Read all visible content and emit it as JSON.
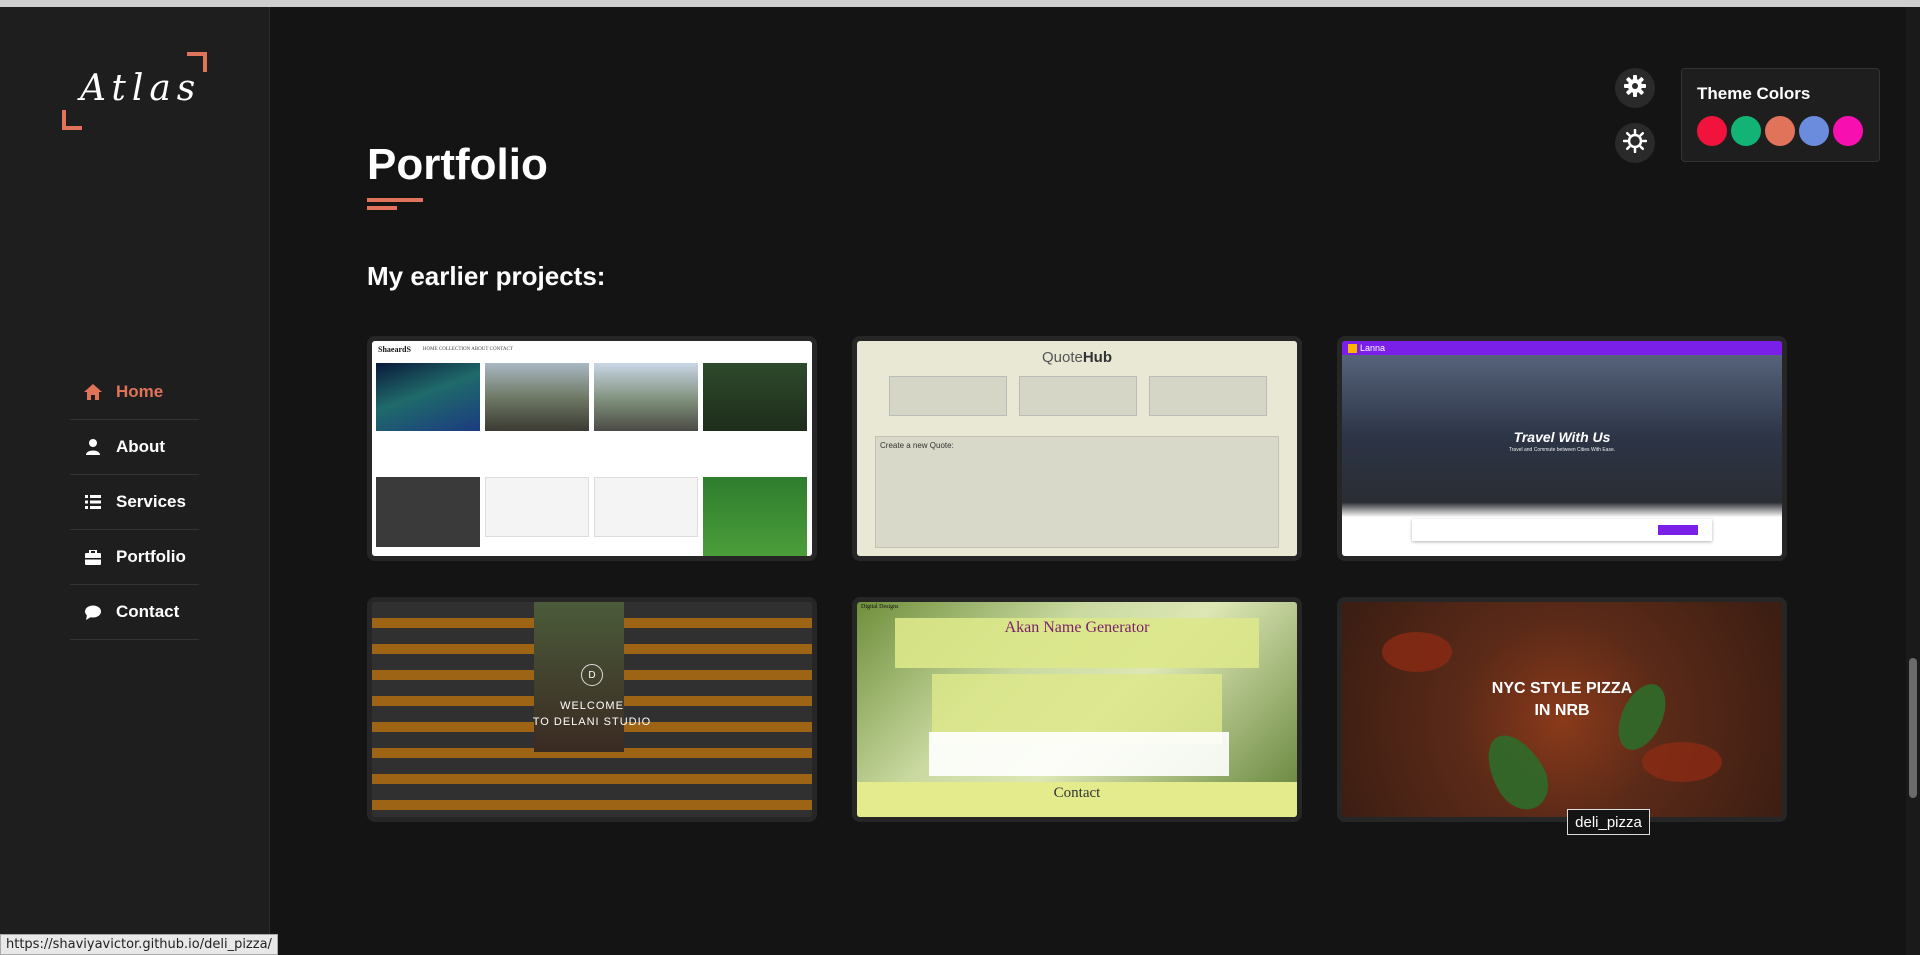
{
  "logo": {
    "text": "Atlas"
  },
  "nav": [
    {
      "label": "Home",
      "icon": "home-icon",
      "active": true
    },
    {
      "label": "About",
      "icon": "user-icon",
      "active": false
    },
    {
      "label": "Services",
      "icon": "list-icon",
      "active": false
    },
    {
      "label": "Portfolio",
      "icon": "briefcase-icon",
      "active": false
    },
    {
      "label": "Contact",
      "icon": "comment-icon",
      "active": false
    }
  ],
  "page": {
    "title": "Portfolio",
    "subtitle": "My earlier projects:"
  },
  "theme": {
    "title": "Theme Colors",
    "colors": [
      "#f2133c",
      "#12b374",
      "#e0735a",
      "#6b8cdc",
      "#f80fb0"
    ],
    "accent": "#e0735a"
  },
  "projects": [
    {
      "name": "shaeardi",
      "header": "ShaeardS",
      "links": "HOME  COLLECTION  ABOUT  CONTACT"
    },
    {
      "name": "quotehub",
      "title_a": "Quote",
      "title_b": "Hub",
      "form_title": "Create a new Quote:"
    },
    {
      "name": "lanna",
      "brand": "Lanna",
      "headline": "Travel With Us",
      "tagline": "Travel and Commute between Cities With Ease."
    },
    {
      "name": "delani_studio",
      "line1": "WELCOME",
      "line2": "TO DELANI STUDIO",
      "badge": "D"
    },
    {
      "name": "akan_name_generator",
      "title": "Akan Name Generator",
      "footer": "Contact",
      "brand": "Digital Designs"
    },
    {
      "name": "deli_pizza",
      "line1": "NYC STYLE PIZZA",
      "line2": "IN NRB"
    }
  ],
  "tooltip": "deli_pizza",
  "status_url": "https://shaviyavictor.github.io/deli_pizza/"
}
